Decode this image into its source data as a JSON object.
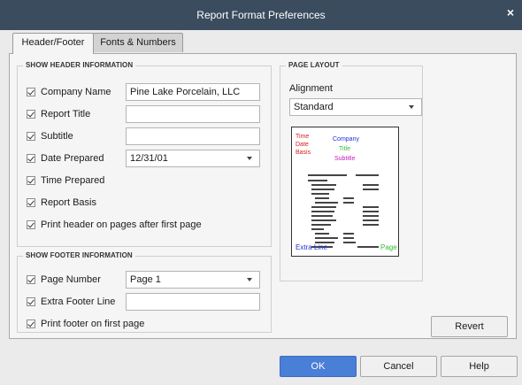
{
  "window": {
    "title": "Report Format Preferences",
    "close_glyph": "×"
  },
  "tabs": [
    {
      "label": "Header/Footer",
      "active": true
    },
    {
      "label": "Fonts & Numbers",
      "active": false
    }
  ],
  "header_section": {
    "title": "SHOW HEADER INFORMATION",
    "items": [
      {
        "label": "Company Name",
        "checked": true,
        "value": "Pine Lake Porcelain, LLC"
      },
      {
        "label": "Report Title",
        "checked": true,
        "value": ""
      },
      {
        "label": "Subtitle",
        "checked": true,
        "value": ""
      },
      {
        "label": "Date Prepared",
        "checked": true,
        "value": "12/31/01"
      },
      {
        "label": "Time Prepared",
        "checked": true
      },
      {
        "label": "Report Basis",
        "checked": true
      },
      {
        "label": "Print header on pages after first page",
        "checked": true
      }
    ]
  },
  "footer_section": {
    "title": "SHOW FOOTER INFORMATION",
    "items": [
      {
        "label": "Page Number",
        "checked": true,
        "value": "Page 1"
      },
      {
        "label": "Extra Footer Line",
        "checked": true,
        "value": ""
      },
      {
        "label": "Print footer on first page",
        "checked": true
      }
    ]
  },
  "page_layout": {
    "title": "PAGE LAYOUT",
    "alignment_label": "Alignment",
    "alignment_value": "Standard",
    "preview": {
      "time": "Time",
      "date": "Date",
      "basis": "Basis",
      "company": "Company",
      "title": "Title",
      "subtitle": "Subtitle",
      "extra_line": "Extra Line",
      "page": "Page",
      "colors": {
        "red": "#d62020",
        "blue": "#2030d0",
        "green": "#30c030",
        "magenta": "#c020c0"
      }
    }
  },
  "buttons": {
    "revert": "Revert",
    "ok": "OK",
    "cancel": "Cancel",
    "help": "Help"
  },
  "colors": {
    "titlebar": "#3a4c5e",
    "ok_button": "#4a7fd8"
  }
}
